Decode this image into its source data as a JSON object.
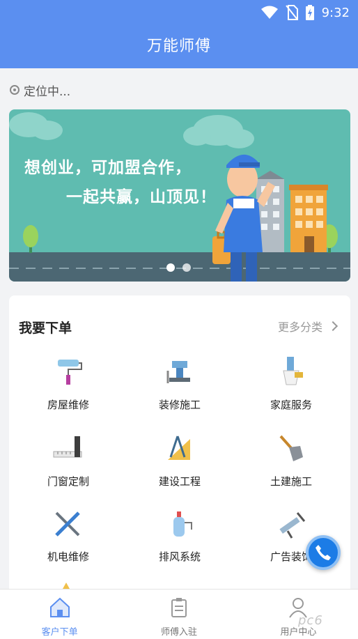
{
  "status": {
    "time": "9:32"
  },
  "app": {
    "title": "万能师傅"
  },
  "location": {
    "text": "定位中..."
  },
  "banner": {
    "line1": "想创业，可加盟合作，",
    "line2": "一起共赢，山顶见！",
    "slides": 2,
    "active_slide": 0
  },
  "section": {
    "title": "我要下单",
    "more_label": "更多分类"
  },
  "categories": [
    {
      "label": "房屋维修",
      "icon": "paint-roller-icon"
    },
    {
      "label": "装修施工",
      "icon": "bench-vise-icon"
    },
    {
      "label": "家庭服务",
      "icon": "cleaning-brush-icon"
    },
    {
      "label": "门窗定制",
      "icon": "ruler-icon"
    },
    {
      "label": "建设工程",
      "icon": "compass-square-icon"
    },
    {
      "label": "土建施工",
      "icon": "shovel-icon"
    },
    {
      "label": "机电维修",
      "icon": "screwdriver-wrench-icon"
    },
    {
      "label": "排风系统",
      "icon": "sprayer-icon"
    },
    {
      "label": "广告装饰",
      "icon": "caulk-gun-icon"
    }
  ],
  "nav": [
    {
      "label": "客户下单",
      "icon": "home-icon",
      "active": true
    },
    {
      "label": "师傅入驻",
      "icon": "clipboard-icon",
      "active": false
    },
    {
      "label": "用户中心",
      "icon": "user-icon",
      "active": false
    }
  ],
  "watermark": "pc6",
  "colors": {
    "primary": "#5b8ff0",
    "banner": "#5fbcb0",
    "fab": "#1c7ce6"
  }
}
